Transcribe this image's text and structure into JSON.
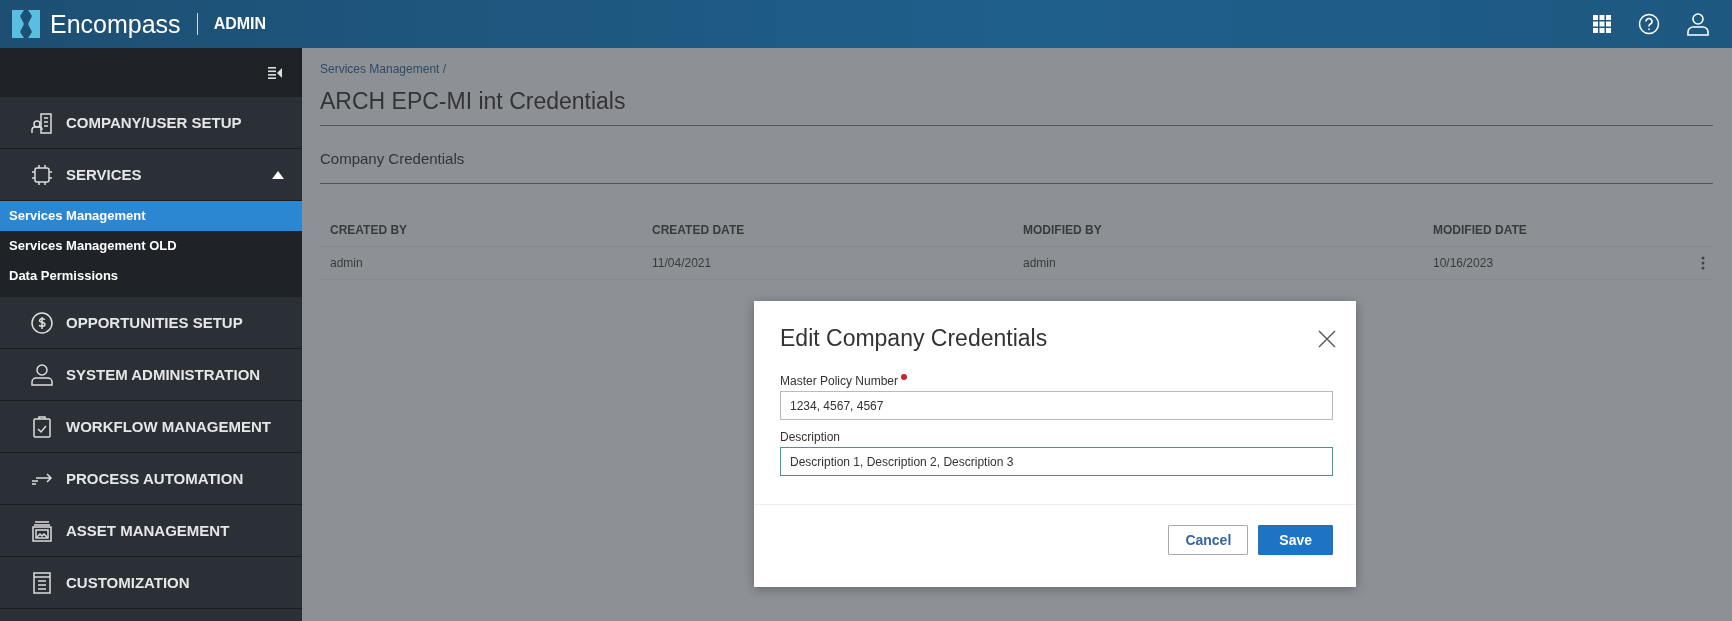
{
  "header": {
    "brand": "Encompass",
    "section": "ADMIN"
  },
  "sidebar": {
    "items": [
      {
        "label": "COMPANY/USER SETUP"
      },
      {
        "label": "SERVICES",
        "expanded": true,
        "children": [
          {
            "label": "Services Management",
            "selected": true
          },
          {
            "label": "Services Management OLD",
            "selected": false
          },
          {
            "label": "Data Permissions",
            "selected": false
          }
        ]
      },
      {
        "label": "OPPORTUNITIES SETUP"
      },
      {
        "label": "SYSTEM ADMINISTRATION"
      },
      {
        "label": "WORKFLOW MANAGEMENT"
      },
      {
        "label": "PROCESS AUTOMATION"
      },
      {
        "label": "ASSET MANAGEMENT"
      },
      {
        "label": "CUSTOMIZATION"
      }
    ]
  },
  "breadcrumb": "Services Management /",
  "title": "ARCH EPC-MI int Credentials",
  "section": "Company Credentials",
  "table": {
    "columns": [
      "CREATED BY",
      "CREATED DATE",
      "MODIFIED BY",
      "MODIFIED DATE"
    ],
    "rows": [
      [
        "admin",
        "11/04/2021",
        "admin",
        "10/16/2023"
      ]
    ]
  },
  "modal": {
    "title": "Edit Company Credentials",
    "fields": [
      {
        "label": "Master Policy Number",
        "required": true,
        "focused": false,
        "value": "1234, 4567, 4567"
      },
      {
        "label": "Description",
        "required": false,
        "focused": true,
        "value": "Description 1, Description 2, Description 3"
      }
    ],
    "buttons": [
      {
        "label": "Cancel",
        "kind": "secondary"
      },
      {
        "label": "Save",
        "kind": "primary"
      }
    ]
  }
}
